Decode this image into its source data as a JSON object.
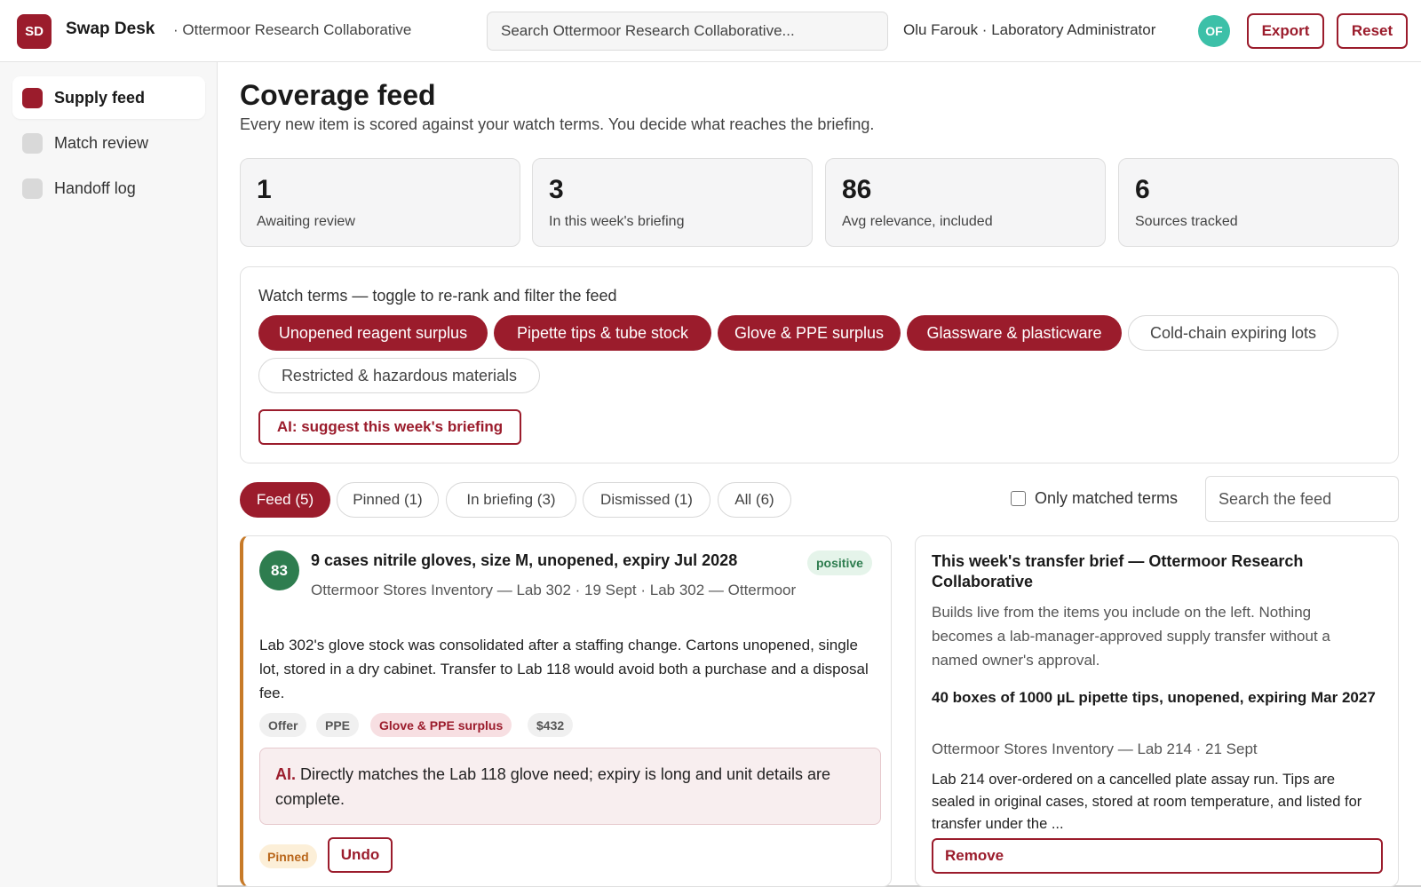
{
  "app": {
    "logo_initials": "SD",
    "title": "Swap Desk",
    "org": "· Ottermoor Research Collaborative",
    "search_placeholder": "Search Ottermoor Research Collaborative...",
    "user": "Olu Farouk · Laboratory Administrator",
    "avatar_initials": "OF",
    "export_label": "Export",
    "reset_label": "Reset"
  },
  "sidebar": {
    "items": [
      {
        "label": "Supply feed",
        "active": true
      },
      {
        "label": "Match review",
        "active": false
      },
      {
        "label": "Handoff log",
        "active": false
      }
    ]
  },
  "page": {
    "title": "Coverage feed",
    "subtitle": "Every new item is scored against your watch terms. You decide what reaches the briefing."
  },
  "stats": [
    {
      "value": "1",
      "label": "Awaiting review"
    },
    {
      "value": "3",
      "label": "In this week's briefing"
    },
    {
      "value": "86",
      "label": "Avg relevance, included"
    },
    {
      "value": "6",
      "label": "Sources tracked"
    }
  ],
  "watch_terms": {
    "heading": "Watch terms — toggle to re-rank and filter the feed",
    "terms": [
      {
        "label": "Unopened reagent surplus",
        "on": true
      },
      {
        "label": "Pipette tips & tube stock",
        "on": true
      },
      {
        "label": "Glove & PPE surplus",
        "on": true
      },
      {
        "label": "Glassware & plasticware",
        "on": true
      },
      {
        "label": "Cold-chain expiring lots",
        "on": false
      },
      {
        "label": "Restricted & hazardous materials",
        "on": false
      }
    ],
    "ai_button": "AI: suggest this week's briefing"
  },
  "tabs": [
    {
      "label": "Feed (5)",
      "active": true
    },
    {
      "label": "Pinned (1)",
      "active": false
    },
    {
      "label": "In briefing (3)",
      "active": false
    },
    {
      "label": "Dismissed (1)",
      "active": false
    },
    {
      "label": "All (6)",
      "active": false
    }
  ],
  "filter": {
    "only_matched_label": "Only matched terms",
    "only_matched_checked": false,
    "search_placeholder": "Search the feed"
  },
  "feed_item": {
    "score": "83",
    "title": "9 cases nitrile gloves, size M, unopened, expiry Jul 2028",
    "sentiment": "positive",
    "meta": "Ottermoor Stores Inventory — Lab 302 · 19 Sept · Lab 302 — Ottermoor",
    "body": "Lab 302's glove stock was consolidated after a staffing change. Cartons unopened, single lot, stored in a dry cabinet. Transfer to Lab 118 would avoid both a purchase and a disposal fee.",
    "tags": [
      "Offer",
      "PPE",
      "Glove & PPE surplus",
      "$432"
    ],
    "ai_label": "AI.",
    "ai_note": "Directly matches the Lab 118 glove need; expiry is long and unit details are complete.",
    "status": "Pinned",
    "undo_label": "Undo"
  },
  "brief": {
    "title": "This week's transfer brief — Ottermoor Research Collaborative",
    "description": "Builds live from the items you include on the left. Nothing becomes a lab-manager-approved supply transfer without a named owner's approval.",
    "item_title": "40 boxes of 1000 µL pipette tips, unopened, expiring Mar 2027",
    "item_meta": "Ottermoor Stores Inventory — Lab 214 · 21 Sept",
    "item_body": "Lab 214 over-ordered on a cancelled plate assay run. Tips are sealed in original cases, stored at room temperature, and listed for transfer under the ...",
    "remove_label": "Remove"
  },
  "colors": {
    "accent": "#9b1c2c",
    "score_green": "#2e7d4f",
    "pinned_orange": "#c77a28",
    "avatar_teal": "#3cc0a8"
  }
}
